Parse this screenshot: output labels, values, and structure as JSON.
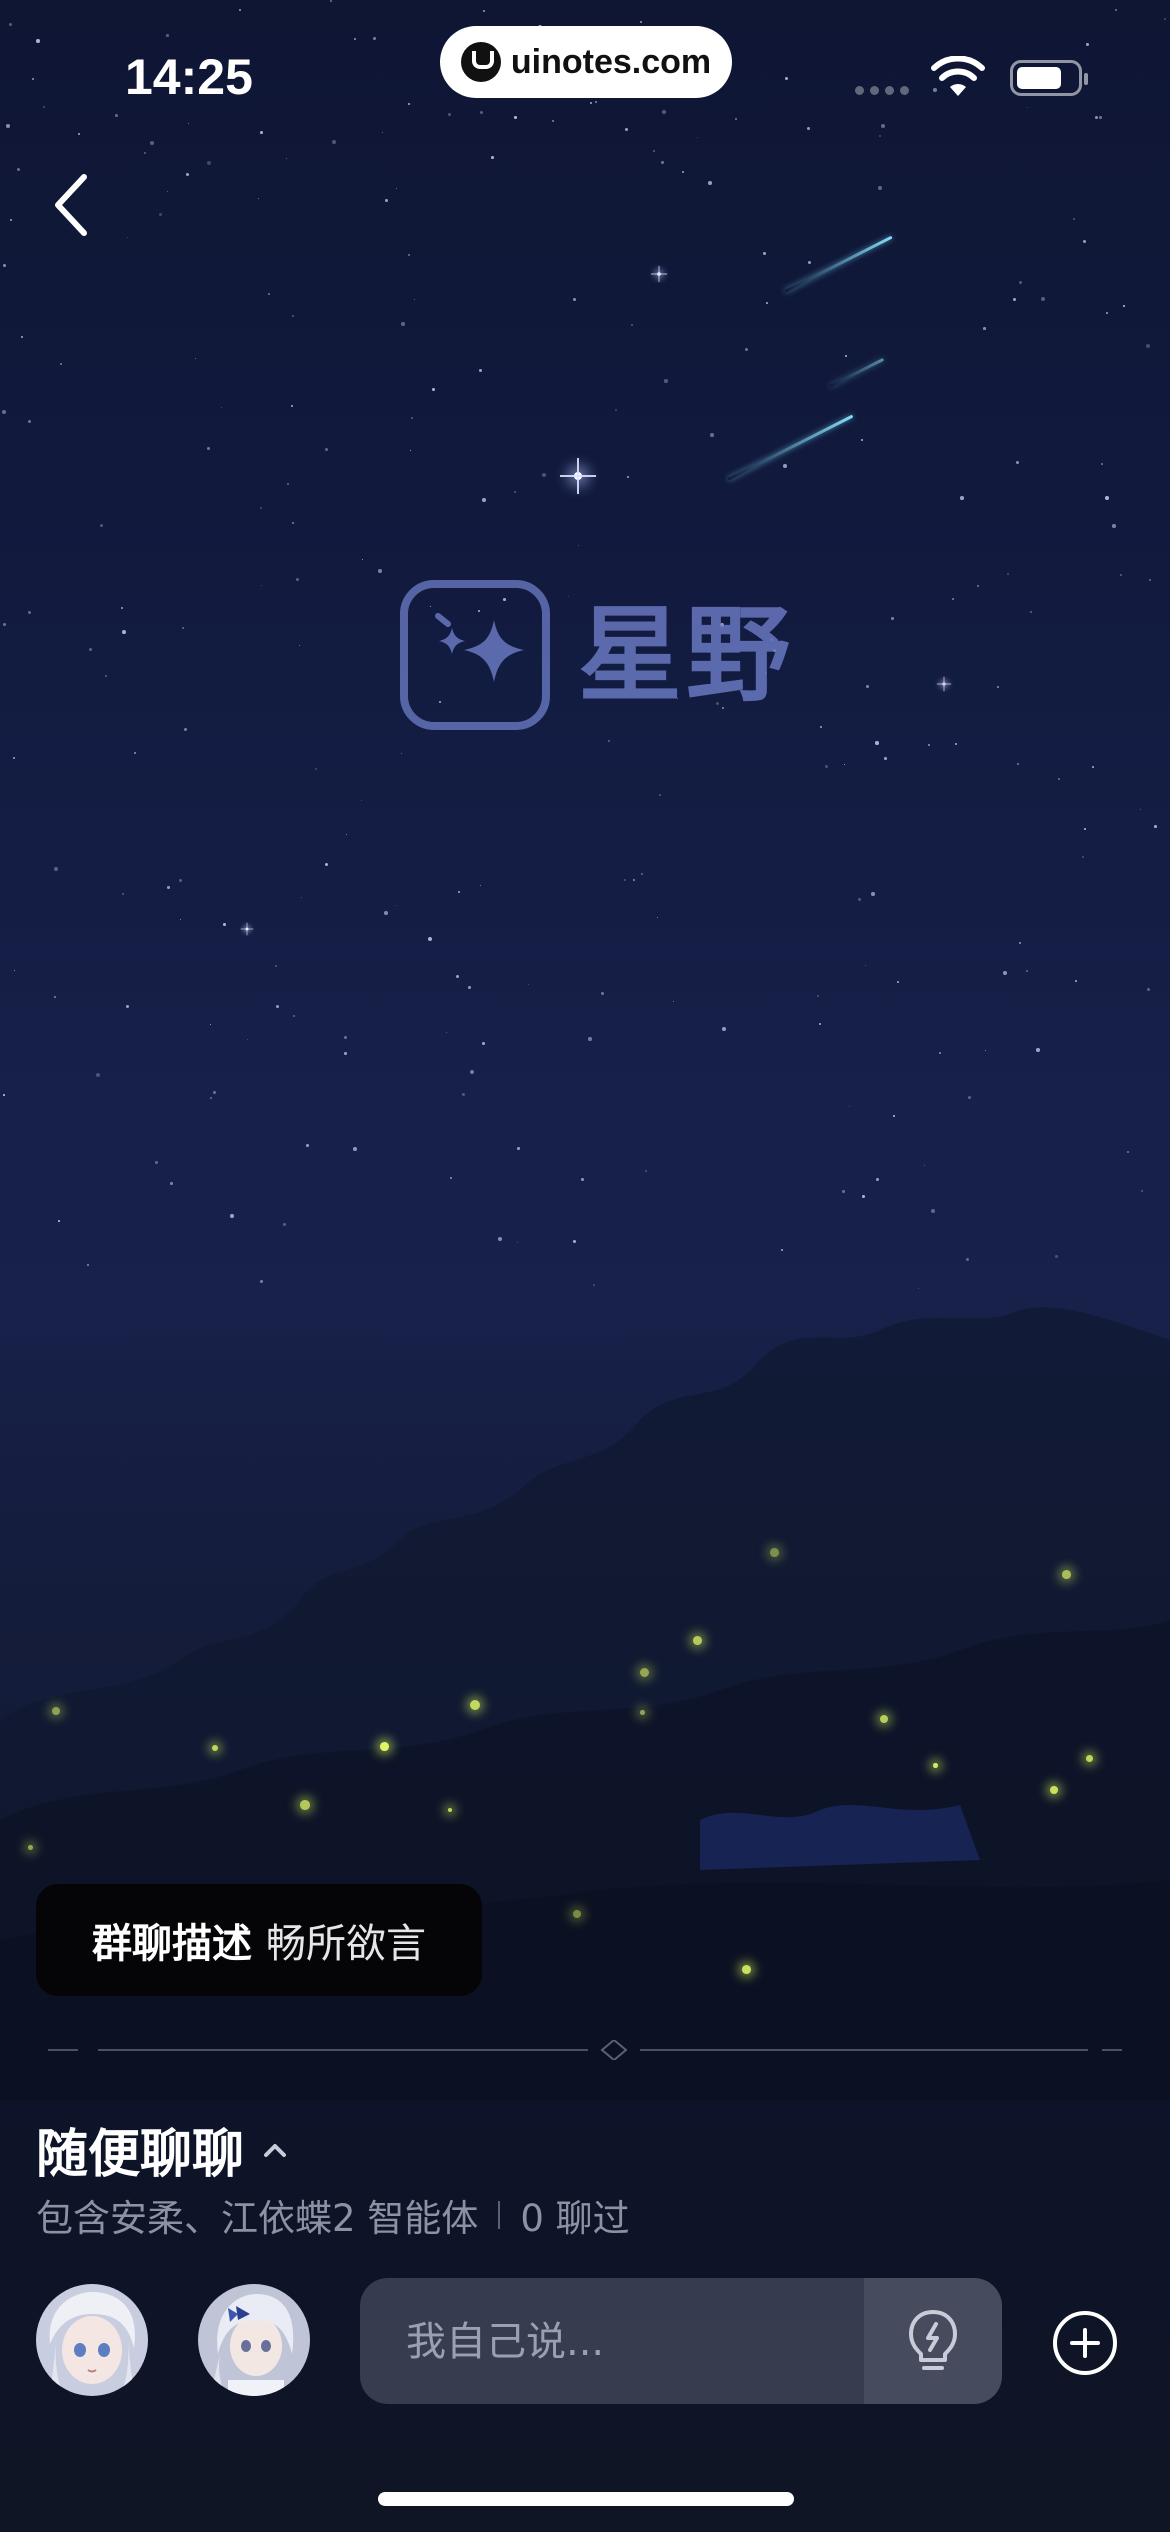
{
  "status_bar": {
    "time": "14:25",
    "url": "uinotes.com"
  },
  "app": {
    "logo_text": "星野"
  },
  "group": {
    "description_label": "群聊描述",
    "description_value": "畅所欲言",
    "title": "随便聊聊",
    "members": "包含安柔、江依蝶2 智能体",
    "chat_count": "0 聊过"
  },
  "composer": {
    "placeholder": "我自己说..."
  },
  "icons": {
    "back": "chevron-left-icon",
    "collapse": "chevron-up-icon",
    "hint": "lightbulb-icon",
    "add": "plus-circle-icon",
    "wifi": "wifi-icon",
    "battery": "battery-icon"
  },
  "colors": {
    "background_top": "#0f1634",
    "background_bottom": "#101526",
    "logo_tint": "#6e7dc8",
    "firefly": "#e8ff6a",
    "meteor": "#8ce6ff"
  }
}
